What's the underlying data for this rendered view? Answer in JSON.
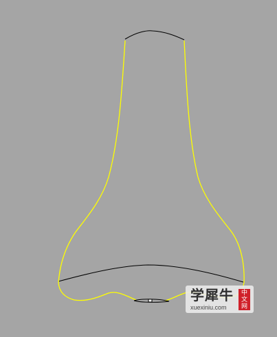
{
  "viewport": {
    "background_color": "#a5a5a5",
    "profile_curve_color": "#ffff00",
    "section_curve_color": "#000000"
  },
  "watermark": {
    "title": "学犀牛",
    "url": "xuexiniu.com",
    "badge_chars": [
      "中",
      "文",
      "网"
    ],
    "badge_color": "#d0202a"
  }
}
